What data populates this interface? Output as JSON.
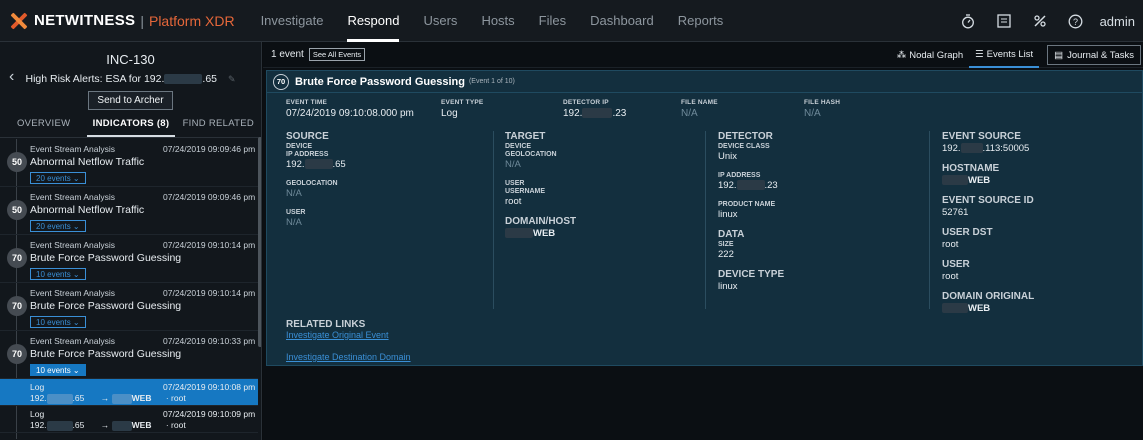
{
  "brand": {
    "name": "NETWITNESS",
    "platform": "Platform XDR"
  },
  "nav": [
    "Investigate",
    "Respond",
    "Users",
    "Hosts",
    "Files",
    "Dashboard",
    "Reports"
  ],
  "nav_active": "Respond",
  "user": "admin",
  "incident": {
    "id": "INC-130",
    "title_prefix": "High Risk Alerts: ESA for 192.",
    "title_suffix": ".65",
    "archer_label": "Send to Archer",
    "tabs": [
      "OVERVIEW",
      "INDICATORS (8)",
      "FIND RELATED"
    ]
  },
  "indicators": [
    {
      "score": "50",
      "source": "Event Stream Analysis",
      "time": "07/24/2019 09:09:46 pm",
      "name": "Abnormal Netflow Traffic",
      "events": "20 events ⌄"
    },
    {
      "score": "50",
      "source": "Event Stream Analysis",
      "time": "07/24/2019 09:09:46 pm",
      "name": "Abnormal Netflow Traffic",
      "events": "20 events ⌄"
    },
    {
      "score": "70",
      "source": "Event Stream Analysis",
      "time": "07/24/2019 09:10:14 pm",
      "name": "Brute Force Password Guessing",
      "events": "10 events ⌄"
    },
    {
      "score": "70",
      "source": "Event Stream Analysis",
      "time": "07/24/2019 09:10:14 pm",
      "name": "Brute Force Password Guessing",
      "events": "10 events ⌄"
    },
    {
      "score": "70",
      "source": "Event Stream Analysis",
      "time": "07/24/2019 09:10:33 pm",
      "name": "Brute Force Password Guessing",
      "events": "10 events ⌄"
    }
  ],
  "events": [
    {
      "type": "Log",
      "time": "07/24/2019 09:10:08 pm",
      "src_prefix": "192.",
      "src_suffix": ".65",
      "dst": "WEB",
      "user": "· root"
    },
    {
      "type": "Log",
      "time": "07/24/2019 09:10:09 pm",
      "src_prefix": "192.",
      "src_suffix": ".65",
      "dst": "WEB",
      "user": "· root"
    }
  ],
  "main": {
    "count": "1 event",
    "see_all": "See All Events",
    "views": [
      "Nodal Graph",
      "Events List",
      "Journal & Tasks"
    ]
  },
  "event": {
    "score": "70",
    "name": "Brute Force Password Guessing",
    "counter": "(Event 1 of 10)",
    "meta": [
      {
        "label": "EVENT TIME",
        "value": "07/24/2019 09:10:08.000 pm"
      },
      {
        "label": "EVENT TYPE",
        "value": "Log"
      },
      {
        "label": "DETECTOR IP",
        "value_prefix": "192.",
        "value_suffix": ".23"
      },
      {
        "label": "FILE NAME",
        "value": "N/A"
      },
      {
        "label": "FILE HASH",
        "value": "N/A"
      }
    ],
    "source": {
      "heading": "SOURCE",
      "device": "DEVICE",
      "ip_label": "IP ADDRESS",
      "ip_prefix": "192.",
      "ip_suffix": ".65",
      "geo_label": "GEOLOCATION",
      "geo": "N/A",
      "user_label": "USER",
      "user": "N/A"
    },
    "target": {
      "heading": "TARGET",
      "device": "DEVICE",
      "geo_label": "GEOLOCATION",
      "geo": "N/A",
      "user_label": "USER",
      "username_label": "USERNAME",
      "username": "root",
      "domain_label": "DOMAIN/HOST",
      "domain": "WEB"
    },
    "detector": {
      "heading": "DETECTOR",
      "class_label": "DEVICE CLASS",
      "class": "Unix",
      "ip_label": "IP ADDRESS",
      "ip_prefix": "192.",
      "ip_suffix": ".23",
      "product_label": "PRODUCT NAME",
      "product": "linux",
      "data_label": "DATA",
      "size_label": "SIZE",
      "size": "222",
      "devtype_label": "DEVICE TYPE",
      "devtype": "linux"
    },
    "event_source": {
      "heading": "EVENT SOURCE",
      "value_prefix": "192.",
      "value_suffix": ".113:50005",
      "hostname_label": "HOSTNAME",
      "hostname": "WEB",
      "esid_label": "EVENT SOURCE ID",
      "esid": "52761",
      "userdst_label": "USER DST",
      "userdst": "root",
      "user_label": "USER",
      "user": "root",
      "domorig_label": "DOMAIN ORIGINAL",
      "domorig": "WEB"
    },
    "links_heading": "RELATED LINKS",
    "links": [
      "Investigate Original Event",
      "Investigate Destination Domain"
    ]
  }
}
